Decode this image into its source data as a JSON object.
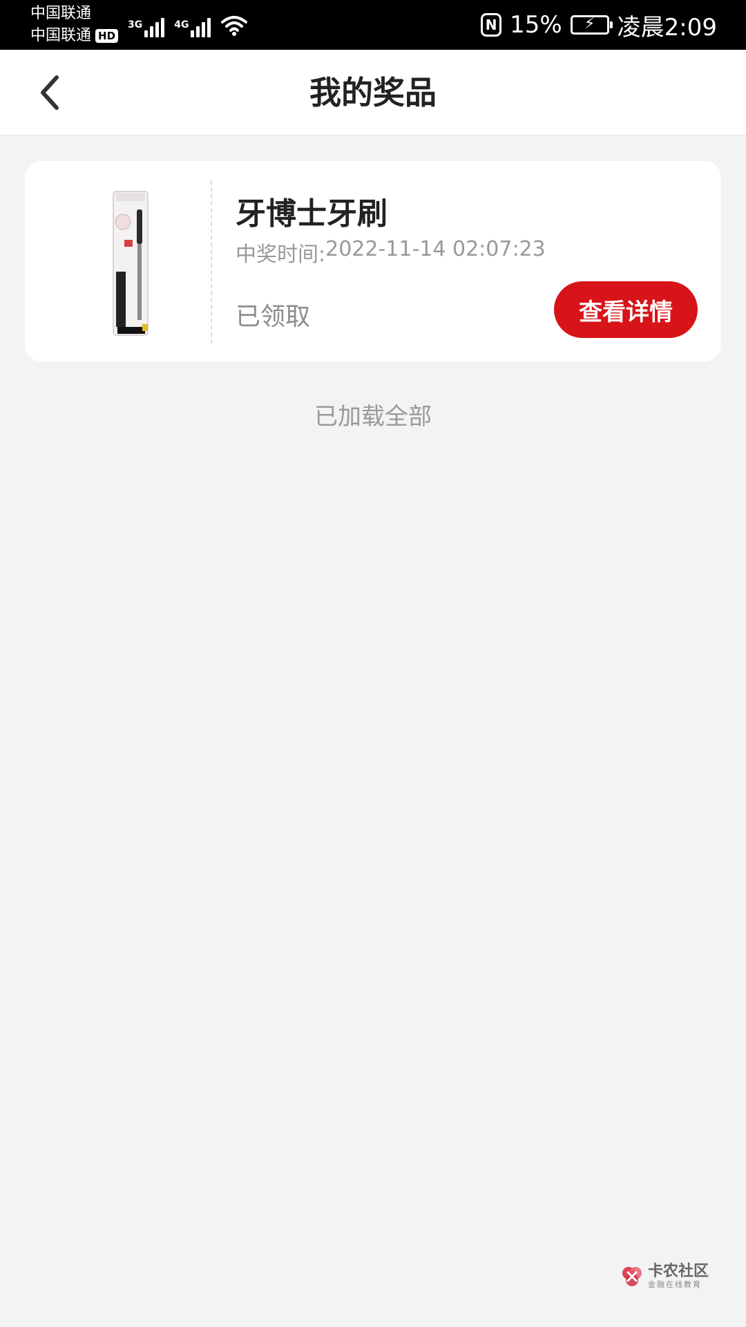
{
  "status_bar": {
    "carrier_1": "中国联通",
    "carrier_2": "中国联通",
    "hd_badge": "HD",
    "network_1": "3G",
    "network_2": "4G",
    "battery_percent": "15%",
    "time": "凌晨2:09",
    "nfc_label": "N"
  },
  "header": {
    "title": "我的奖品"
  },
  "prizes": [
    {
      "name": "牙博士牙刷",
      "win_time_label": "中奖时间:",
      "win_time": "2022-11-14 02:07:23",
      "status": "已领取",
      "detail_button": "查看详情"
    }
  ],
  "footer": {
    "loaded_all": "已加载全部"
  },
  "watermark": {
    "title": "卡农社区",
    "subtitle": "金融在线教育"
  },
  "colors": {
    "accent": "#d7141a",
    "background": "#f2f3f5"
  }
}
